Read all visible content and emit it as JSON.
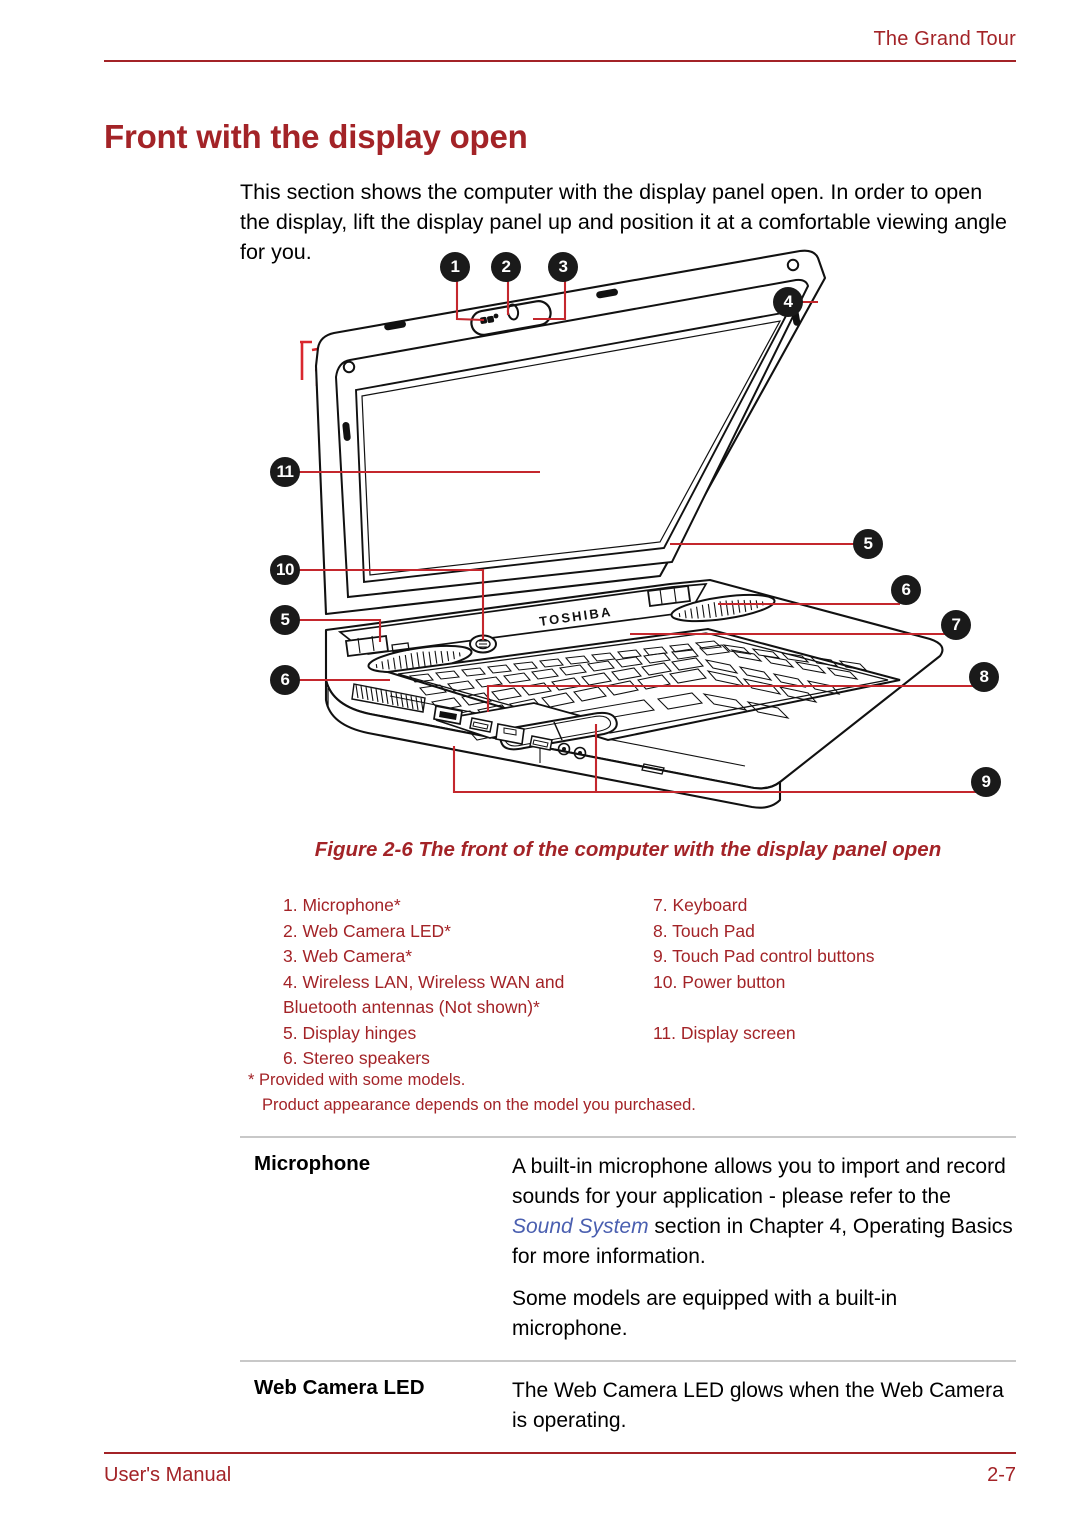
{
  "header": {
    "title": "The Grand Tour"
  },
  "section": {
    "heading": "Front with the display open",
    "intro": "This section shows the computer with the display panel open. In order to open the display, lift the display panel up and position it at a comfortable viewing angle for you."
  },
  "figure": {
    "caption": "Figure 2-6 The front of the computer with the display panel open",
    "brand_label": "TOSHIBA",
    "callouts": [
      {
        "id": "1",
        "label": "1"
      },
      {
        "id": "2",
        "label": "2"
      },
      {
        "id": "3",
        "label": "3"
      },
      {
        "id": "4",
        "label": "4"
      },
      {
        "id": "5r",
        "label": "5"
      },
      {
        "id": "6r",
        "label": "6"
      },
      {
        "id": "7",
        "label": "7"
      },
      {
        "id": "8",
        "label": "8"
      },
      {
        "id": "9",
        "label": "9"
      },
      {
        "id": "11",
        "label": "11"
      },
      {
        "id": "10",
        "label": "10"
      },
      {
        "id": "5l",
        "label": "5"
      },
      {
        "id": "6l",
        "label": "6"
      }
    ]
  },
  "legend": {
    "left": [
      "1. Microphone*",
      "2. Web Camera LED*",
      "3. Web Camera*",
      "4. Wireless LAN, Wireless WAN and\nBluetooth antennas (Not shown)*",
      "5. Display hinges",
      "6. Stereo speakers"
    ],
    "right": [
      "7. Keyboard",
      "8. Touch Pad",
      "9. Touch Pad control buttons",
      "10. Power button",
      "11. Display screen"
    ]
  },
  "footnotes": {
    "line1": "* Provided with some models.",
    "line2": "Product appearance depends on the model you purchased."
  },
  "definitions": [
    {
      "term": "Microphone",
      "paragraph1_before": "A built-in microphone allows you to import and record sounds for your application - please refer to the ",
      "xref": "Sound System",
      "paragraph1_after": " section in Chapter 4, Operating Basics for more information.",
      "paragraph2": "Some models are equipped with a built-in microphone."
    },
    {
      "term": "Web Camera LED",
      "paragraph1_before": "The Web Camera LED glows when the Web Camera is operating.",
      "xref": "",
      "paragraph1_after": "",
      "paragraph2": ""
    }
  ],
  "footer": {
    "left": "User's Manual",
    "page": "2-7"
  },
  "colors": {
    "accent_red": "#A32327",
    "callout_bg": "#1a1a1a",
    "xref_blue": "#4a5fb0",
    "rule_gray": "#c8c8c8"
  }
}
